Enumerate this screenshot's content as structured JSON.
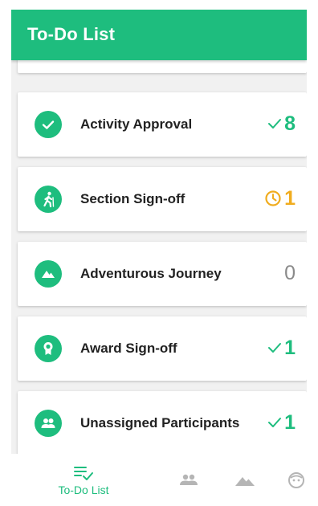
{
  "header": {
    "title": "To-Do List"
  },
  "items": [
    {
      "label": "Activity Approval",
      "count": "8",
      "status": "check",
      "icon": "check-circle-icon"
    },
    {
      "label": "Section Sign-off",
      "count": "1",
      "status": "clock",
      "icon": "hiker-icon"
    },
    {
      "label": "Adventurous Journey",
      "count": "0",
      "status": "none",
      "icon": "mountain-icon"
    },
    {
      "label": "Award Sign-off",
      "count": "1",
      "status": "check",
      "icon": "award-ribbon-icon"
    },
    {
      "label": "Unassigned Participants",
      "count": "1",
      "status": "check",
      "icon": "group-icon"
    }
  ],
  "nav": {
    "todo_label": "To-Do List",
    "tabs": [
      "to-do-list-tab",
      "participants-tab",
      "adventurous-journey-tab",
      "profile-tab"
    ]
  },
  "colors": {
    "accent": "#1ebd7e",
    "pending": "#f0ac1e",
    "muted": "#8a8a8a"
  }
}
